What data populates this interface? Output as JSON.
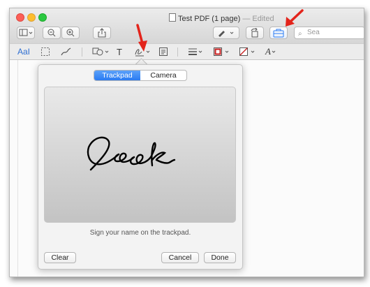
{
  "window": {
    "title": "Test PDF (1 page)",
    "title_separator": "—",
    "title_status": "Edited"
  },
  "toolbar": {
    "search_placeholder": "Sea"
  },
  "markup": {
    "text_style_label": "AaI",
    "text_tool_label": "T",
    "font_tool_label": "A"
  },
  "signature_popover": {
    "tabs": [
      {
        "label": "Trackpad",
        "selected": true
      },
      {
        "label": "Camera",
        "selected": false
      }
    ],
    "instruction": "Sign your name on the trackpad.",
    "clear_label": "Clear",
    "cancel_label": "Cancel",
    "done_label": "Done"
  },
  "colors": {
    "accent": "#2a7bf2",
    "annotation_arrow": "#e3241b",
    "border_tool": "#c81e1e"
  }
}
